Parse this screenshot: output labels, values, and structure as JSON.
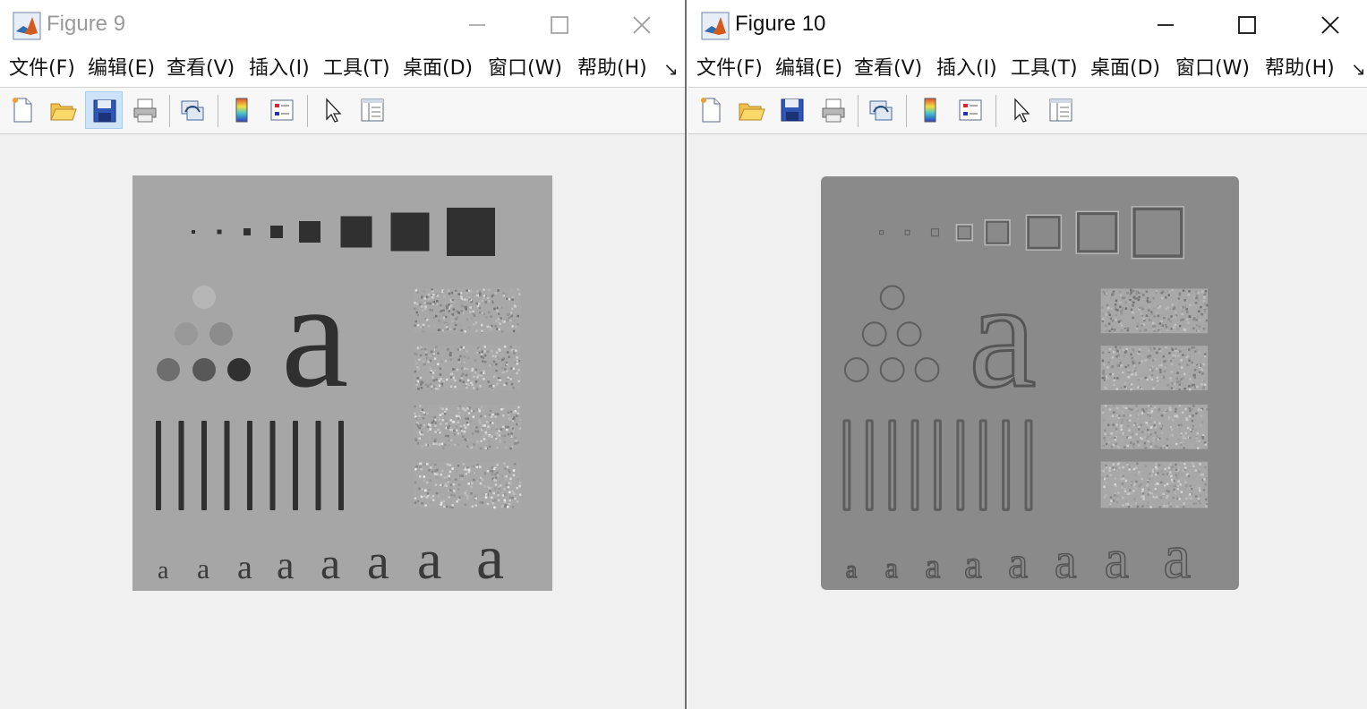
{
  "windows": [
    {
      "title": "Figure 9",
      "active": false,
      "menu": [
        "文件(F)",
        "编辑(E)",
        "查看(V)",
        "插入(I)",
        "工具(T)",
        "桌面(D)",
        "窗口(W)",
        "帮助(H)"
      ],
      "menu_overflow": "↘",
      "toolbar": [
        "new-figure",
        "open-file",
        "save-figure",
        "print-figure",
        "link-plot",
        "insert-colorbar",
        "insert-legend",
        "edit-plot",
        "property-inspector"
      ],
      "selected_tool": "save-figure",
      "image_style": "original"
    },
    {
      "title": "Figure 10",
      "active": true,
      "menu": [
        "文件(F)",
        "编辑(E)",
        "查看(V)",
        "插入(I)",
        "工具(T)",
        "桌面(D)",
        "窗口(W)",
        "帮助(H)"
      ],
      "menu_overflow": "↘",
      "toolbar": [
        "new-figure",
        "open-file",
        "save-figure",
        "print-figure",
        "link-plot",
        "insert-colorbar",
        "insert-legend",
        "edit-plot",
        "property-inspector"
      ],
      "selected_tool": null,
      "image_style": "edge-enhanced"
    }
  ],
  "colors": {
    "window_bg": "#f0f0f0",
    "titlebar_bg": "#ffffff",
    "image_bg_original": "#a6a6a6",
    "image_bg_filtered": "#8a8a8a",
    "dark_shape": "#303030"
  }
}
